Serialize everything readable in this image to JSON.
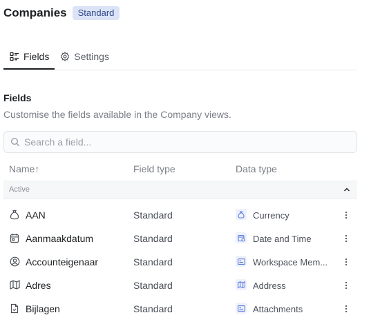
{
  "header": {
    "title": "Companies",
    "badge": "Standard"
  },
  "tabs": [
    {
      "label": "Fields",
      "icon": "fields-list-icon"
    },
    {
      "label": "Settings",
      "icon": "gear-icon"
    }
  ],
  "section": {
    "title": "Fields",
    "description": "Customise the fields available in the Company views."
  },
  "search": {
    "placeholder": "Search a field...",
    "value": ""
  },
  "columns": {
    "name": "Name",
    "sort_indicator": "↑",
    "field_type": "Field type",
    "data_type": "Data type"
  },
  "group": {
    "label": "Active"
  },
  "rows": [
    {
      "name": "AAN",
      "icon": "money-bag-icon",
      "field_type": "Standard",
      "data_type": "Currency",
      "data_type_icon": "currency-icon"
    },
    {
      "name": "Aanmaakdatum",
      "icon": "calendar-icon",
      "field_type": "Standard",
      "data_type": "Date and Time",
      "data_type_icon": "calendar-clock-icon"
    },
    {
      "name": "Accounteigenaar",
      "icon": "user-circle-icon",
      "field_type": "Standard",
      "data_type": "Workspace Mem...",
      "data_type_icon": "id-card-icon"
    },
    {
      "name": "Adres",
      "icon": "map-icon",
      "field_type": "Standard",
      "data_type": "Address",
      "data_type_icon": "map-icon"
    },
    {
      "name": "Bijlagen",
      "icon": "file-icon",
      "field_type": "Standard",
      "data_type": "Attachments",
      "data_type_icon": "id-card-icon"
    }
  ],
  "colors": {
    "accent": "#5b7be0",
    "badge_bg": "#dbe3f7",
    "badge_text": "#334a8a"
  }
}
